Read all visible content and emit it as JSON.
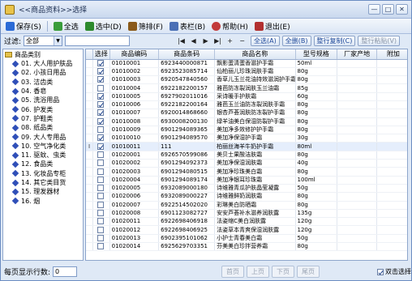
{
  "window": {
    "title": "<<商品资料>>选择"
  },
  "toolbar": {
    "items": [
      {
        "label": "保存(S)",
        "color": "#2b6bd6",
        "icon": "save-icon"
      },
      {
        "label": "全选",
        "color": "#3a9d3a",
        "icon": "check-all-icon"
      },
      {
        "label": "选中(D)",
        "color": "#2d8a2d",
        "icon": "select-icon"
      },
      {
        "label": "筛排(F)",
        "color": "#8a5a1a",
        "icon": "filter-icon"
      },
      {
        "label": "表栏(B)",
        "color": "#4a6fb6",
        "icon": "table-columns-icon"
      },
      {
        "label": "帮助(H)",
        "color": "#c23a3a",
        "icon": "help-icon"
      },
      {
        "label": "退出(E)",
        "color": "#b23030",
        "icon": "exit-icon"
      }
    ]
  },
  "filter": {
    "label": "过滤:",
    "value": "全部",
    "nav": [
      "|◀",
      "◀",
      "▶",
      "▶|",
      "+",
      "−"
    ],
    "buttons": [
      {
        "label": "全选(A)",
        "enabled": true
      },
      {
        "label": "全删(B)",
        "enabled": true
      },
      {
        "label": "整行复制(C)",
        "enabled": true
      },
      {
        "label": "整行粘贴(V)",
        "enabled": false
      }
    ]
  },
  "tree": {
    "root": "商品类别",
    "items": [
      "01. 大人用护肤品",
      "02. 小孩日用品",
      "03. 洁齿类",
      "04. 香皂",
      "05. 洗浴用品",
      "06. 护发类",
      "07. 护鞋类",
      "08. 纸品类",
      "09. 大人专用品",
      "10. 空气净化类",
      "11. 驱蚊、虫类",
      "12. 食品类",
      "13. 化妆品专柜",
      "14. 其它类目货",
      "15. 理发器材",
      "16. 烟"
    ]
  },
  "grid": {
    "columns": [
      "选择",
      "商品编码",
      "商品条码",
      "商品名称",
      "型号规格",
      "厂家产地",
      "附加"
    ],
    "rows": [
      {
        "checked": true,
        "code": "01010001",
        "barcode": "6923440000871",
        "name": "飘影蛋清蛋香滋护手霜",
        "spec": "50ml",
        "origin": ""
      },
      {
        "checked": true,
        "code": "01010002",
        "barcode": "6923523085714",
        "name": "仙柏丽儿珍珠润肤手霜",
        "spec": "80g",
        "origin": ""
      },
      {
        "checked": true,
        "code": "01010003",
        "barcode": "6920547840560",
        "name": "香草儿玉兰花油持效滋润护手霜",
        "spec": "80g",
        "origin": ""
      },
      {
        "checked": false,
        "code": "01010004",
        "barcode": "6922182200157",
        "name": "雅芭防冻裂润肤玉兰油霜",
        "spec": "85g",
        "origin": ""
      },
      {
        "checked": true,
        "code": "01010005",
        "barcode": "6927902011016",
        "name": "采诗暖手护肤霜",
        "spec": "60g",
        "origin": ""
      },
      {
        "checked": true,
        "code": "01010006",
        "barcode": "6922182200164",
        "name": "雅芭玉兰油防冻裂润肤手霜",
        "spec": "80g",
        "origin": ""
      },
      {
        "checked": true,
        "code": "01010007",
        "barcode": "6920014868660",
        "name": "银杏芦荟润肤防冻裂护手霜",
        "spec": "80g",
        "origin": ""
      },
      {
        "checked": true,
        "code": "01010008",
        "barcode": "6930008200130",
        "name": "绿羊油美白保湿防裂护手霜",
        "spec": "80g",
        "origin": ""
      },
      {
        "checked": false,
        "code": "01010009",
        "barcode": "6901294089365",
        "name": "美加净多效修护护手霜",
        "spec": "80g",
        "origin": ""
      },
      {
        "checked": true,
        "code": "01010010",
        "barcode": "6901294089570",
        "name": "美加净保湿护手霜",
        "spec": "30g",
        "origin": ""
      },
      {
        "checked": true,
        "code": "01010011",
        "barcode": "111",
        "name": "柏丽丝海羊牛奶护手霜",
        "spec": "80ml",
        "origin": "",
        "selected": true
      },
      {
        "checked": false,
        "code": "01020001",
        "barcode": "6926570599086",
        "name": "美贝士果酸洁肤霜",
        "spec": "80g",
        "origin": ""
      },
      {
        "checked": false,
        "code": "01020002",
        "barcode": "6901294092373",
        "name": "美加净保湿润肤霜",
        "spec": "40g",
        "origin": ""
      },
      {
        "checked": false,
        "code": "01020003",
        "barcode": "6901294080515",
        "name": "美加净珍珠美白霜",
        "spec": "80g",
        "origin": ""
      },
      {
        "checked": false,
        "code": "01020004",
        "barcode": "6901294089174",
        "name": "美加净银耳珍珠霜",
        "spec": "100ml",
        "origin": ""
      },
      {
        "checked": false,
        "code": "01020005",
        "barcode": "6932089000180",
        "name": "诗维雅青瓜护肤晶莹凝露",
        "spec": "50g",
        "origin": ""
      },
      {
        "checked": false,
        "code": "01020006",
        "barcode": "6932089000227",
        "name": "诗维雅鲜奶润肤霜",
        "spec": "80g",
        "origin": ""
      },
      {
        "checked": false,
        "code": "01020007",
        "barcode": "6922514502020",
        "name": "彩琳美白防晒霜",
        "spec": "80g",
        "origin": ""
      },
      {
        "checked": false,
        "code": "01020008",
        "barcode": "6901123082727",
        "name": "安安芦荟补水滋养润肤露",
        "spec": "135g",
        "origin": ""
      },
      {
        "checked": false,
        "code": "01020011",
        "barcode": "6922698406918",
        "name": "法姿缩C美白润肤露",
        "spec": "120g",
        "origin": ""
      },
      {
        "checked": false,
        "code": "01020012",
        "barcode": "6922698406925",
        "name": "法姿草本青爽保湿润肤露",
        "spec": "120g",
        "origin": ""
      },
      {
        "checked": false,
        "code": "01020013",
        "barcode": "6902395101062",
        "name": "小护士青春美白霜",
        "spec": "50g",
        "origin": ""
      },
      {
        "checked": false,
        "code": "01020014",
        "barcode": "6925629703351",
        "name": "芬美美白珍拌营养霜",
        "spec": "80g",
        "origin": ""
      }
    ]
  },
  "status": {
    "page_rows_label": "每页显示行数:",
    "page_rows_value": "0",
    "pager": [
      "首页",
      "上页",
      "下页",
      "尾页"
    ],
    "check_all_label": "双击选择",
    "check_all_checked": true
  }
}
